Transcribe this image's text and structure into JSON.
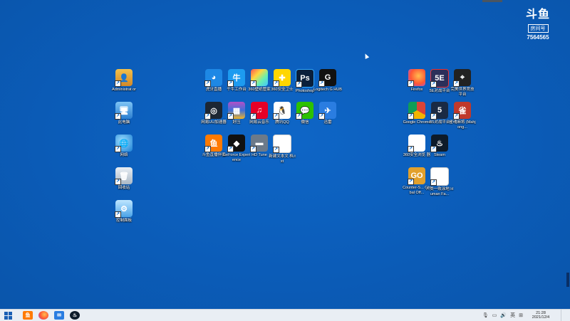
{
  "desktop": {
    "icons": [
      {
        "key": "administrator",
        "label": "Administrat or",
        "glyph": "👤",
        "cls": "i-user"
      },
      {
        "key": "this-pc",
        "label": "此电脑",
        "glyph": "🖥",
        "cls": "i-pc"
      },
      {
        "key": "network",
        "label": "网络",
        "glyph": "🌐",
        "cls": "i-net"
      },
      {
        "key": "recycle-bin",
        "label": "回收站",
        "glyph": "🗑",
        "cls": "i-bin"
      },
      {
        "key": "control-panel",
        "label": "控制面板",
        "glyph": "⚙",
        "cls": "i-ctrl"
      },
      {
        "key": "huya",
        "label": "虎牙直播",
        "glyph": "◕",
        "cls": "i-huya"
      },
      {
        "key": "qianniu",
        "label": "千牛工作台",
        "glyph": "牛",
        "cls": "i-qn"
      },
      {
        "key": "360-wallpaper",
        "label": "360壁纸管家",
        "glyph": "",
        "cls": "i-360w"
      },
      {
        "key": "360-safe",
        "label": "360安全卫士",
        "glyph": "✚",
        "cls": "i-360s"
      },
      {
        "key": "photoshop",
        "label": "Photoshop",
        "glyph": "Ps",
        "cls": "i-ps"
      },
      {
        "key": "logitech",
        "label": "Logitech G HUB",
        "glyph": "G",
        "cls": "i-lg"
      },
      {
        "key": "netease-uu",
        "label": "网易UU加速器",
        "glyph": "◎",
        "cls": "i-vpn"
      },
      {
        "key": "winrar",
        "label": "好压",
        "glyph": "▦",
        "cls": "i-rar"
      },
      {
        "key": "netease-music",
        "label": "网易云音乐",
        "glyph": "♫",
        "cls": "i-ne"
      },
      {
        "key": "tencent-qq",
        "label": "腾讯QQ",
        "glyph": "🐧",
        "cls": "i-qq"
      },
      {
        "key": "wechat",
        "label": "微信",
        "glyph": "💬",
        "cls": "i-wx"
      },
      {
        "key": "feishu",
        "label": "迅雷",
        "glyph": "✈",
        "cls": "i-fly"
      },
      {
        "key": "douyu",
        "label": "斗鱼直播伴侣",
        "glyph": "鱼",
        "cls": "i-douyu"
      },
      {
        "key": "geforce",
        "label": "GeForce Experience",
        "glyph": "◆",
        "cls": "i-nv"
      },
      {
        "key": "hd-tune",
        "label": "HD Tune",
        "glyph": "▬",
        "cls": "i-hd"
      },
      {
        "key": "new-text",
        "label": "新建文本文 档.txt",
        "glyph": "",
        "cls": "i-txt"
      },
      {
        "key": "firefox",
        "label": "Firefox",
        "glyph": "",
        "cls": "i-ff"
      },
      {
        "key": "5e-platform",
        "label": "5E对战平台",
        "glyph": "5E",
        "cls": "i-5e"
      },
      {
        "key": "pubg-platform",
        "label": "完美世界竞技 平台",
        "glyph": "⌖",
        "cls": "i-pubg"
      },
      {
        "key": "chrome",
        "label": "Google Chrome",
        "glyph": "",
        "cls": "i-chrome"
      },
      {
        "key": "b5-platform",
        "label": "B5对战平台",
        "glyph": "5",
        "cls": "i-b5"
      },
      {
        "key": "mahjong",
        "label": "雀魂麻将 (Mahjong...",
        "glyph": "雀",
        "cls": "i-mj"
      },
      {
        "key": "360-browser",
        "label": "360安全浏览 器",
        "glyph": "e",
        "cls": "i-ie"
      },
      {
        "key": "steam",
        "label": "Steam",
        "glyph": "♨",
        "cls": "i-steam"
      },
      {
        "key": "csgo",
        "label": "Counter-S... Global Off...",
        "glyph": "GO",
        "cls": "i-cs"
      },
      {
        "key": "human-fall",
        "label": "人类一败涂地 Human Fa...",
        "glyph": "",
        "cls": "i-txt"
      }
    ]
  },
  "watermark": {
    "logo": "斗鱼",
    "sub": "房间号",
    "room": "7564565"
  },
  "taskbar": {
    "start_icon": "windows-start-icon",
    "pinned": [
      {
        "key": "douyu",
        "glyph": "鱼",
        "cls": "tb-douyu"
      },
      {
        "key": "firefox",
        "glyph": "",
        "cls": "tb-ff"
      },
      {
        "key": "mail",
        "glyph": "✉",
        "cls": "tb-mail"
      },
      {
        "key": "steam",
        "glyph": "♨",
        "cls": "tb-steam"
      }
    ],
    "tray": {
      "mic": "🎙",
      "network": "▭",
      "volume": "🔊",
      "ime": "英",
      "keyboard": "⊞"
    },
    "clock": {
      "time": "21:28",
      "date": "2021/12/4"
    }
  }
}
